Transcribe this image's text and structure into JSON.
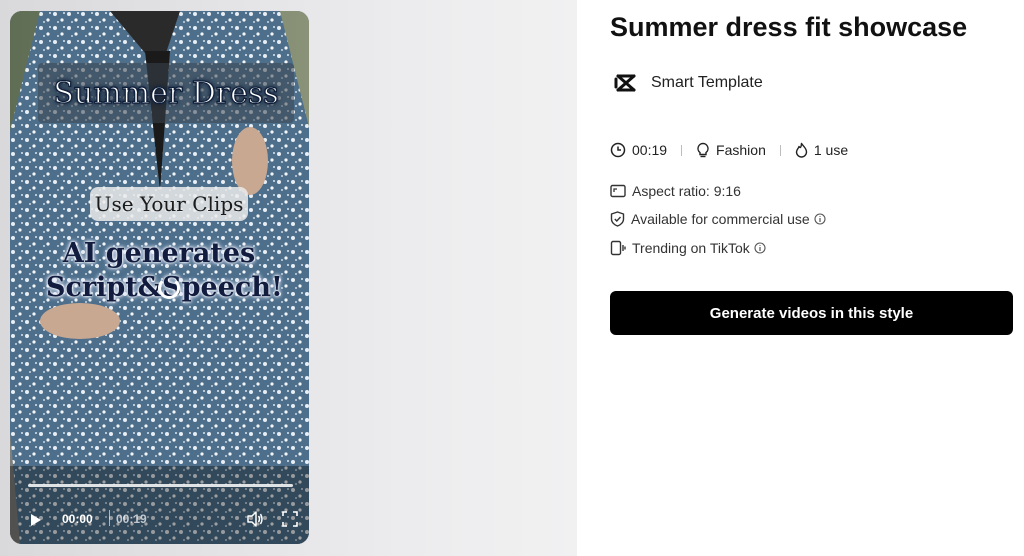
{
  "preview": {
    "overlay_title": "Summer Dress",
    "overlay_clips": "Use Your Clips",
    "overlay_ai_line1": "AI generates",
    "overlay_ai_line2": "Script&Speech!",
    "player": {
      "current_time": "00:00",
      "total_time": "00:19",
      "progress": 0
    }
  },
  "details": {
    "title": "Summer dress fit showcase",
    "template_type": "Smart Template",
    "meta": {
      "duration": "00:19",
      "category": "Fashion",
      "uses": "1 use"
    },
    "info": {
      "aspect_ratio": "Aspect ratio: 9:16",
      "commercial": "Available for commercial use",
      "trending": "Trending on TikTok"
    },
    "generate_button": "Generate videos in this style"
  },
  "colors": {
    "button_bg": "#000000",
    "button_text": "#ffffff",
    "dress_blue": "#4a6a86"
  },
  "icons": [
    "capcut-logo-icon",
    "clock-icon",
    "lightbulb-icon",
    "flame-icon",
    "aspect-ratio-icon",
    "shield-check-icon",
    "phone-icon",
    "info-icon",
    "play-icon",
    "volume-icon",
    "fullscreen-icon"
  ]
}
